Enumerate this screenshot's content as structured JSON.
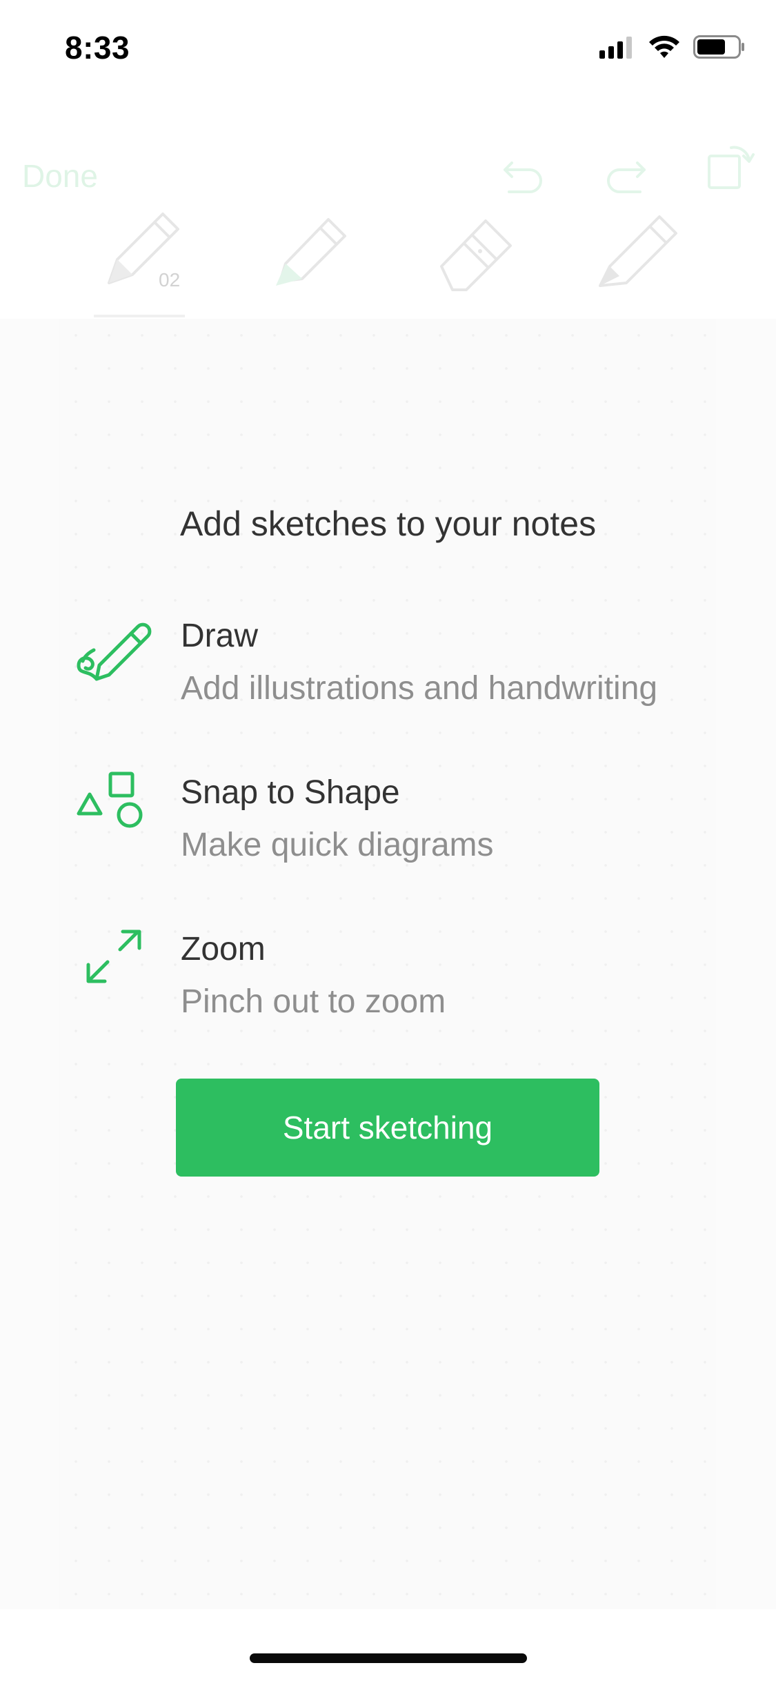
{
  "status_bar": {
    "time": "8:33"
  },
  "toolbar": {
    "done_label": "Done",
    "active_tool_number": "02",
    "icons": [
      "undo-icon",
      "redo-icon",
      "rotate-icon",
      "pen-icon",
      "highlighter-icon",
      "eraser-icon",
      "knife-icon"
    ]
  },
  "onboarding": {
    "title": "Add sketches to your notes",
    "features": [
      {
        "title": "Draw",
        "description": "Add illustrations and handwriting",
        "icon": "draw-pen-icon"
      },
      {
        "title": "Snap to Shape",
        "description": "Make quick diagrams",
        "icon": "shapes-icon"
      },
      {
        "title": "Zoom",
        "description": "Pinch out to zoom",
        "icon": "zoom-arrows-icon"
      }
    ],
    "cta_label": "Start sketching"
  },
  "colors": {
    "accent": "#2dbe60",
    "title_text": "#333333",
    "secondary_text": "#8e8e8e",
    "faded_accent": "#dff4e6"
  }
}
